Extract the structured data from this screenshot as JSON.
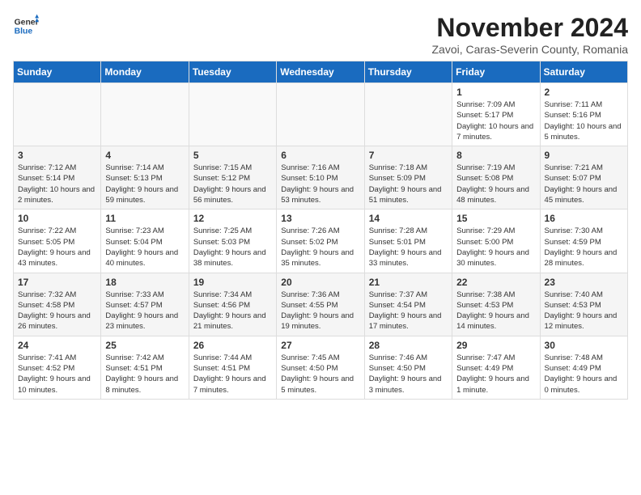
{
  "header": {
    "logo_line1": "General",
    "logo_line2": "Blue",
    "month_title": "November 2024",
    "location": "Zavoi, Caras-Severin County, Romania"
  },
  "weekdays": [
    "Sunday",
    "Monday",
    "Tuesday",
    "Wednesday",
    "Thursday",
    "Friday",
    "Saturday"
  ],
  "weeks": [
    [
      {
        "day": "",
        "info": ""
      },
      {
        "day": "",
        "info": ""
      },
      {
        "day": "",
        "info": ""
      },
      {
        "day": "",
        "info": ""
      },
      {
        "day": "",
        "info": ""
      },
      {
        "day": "1",
        "info": "Sunrise: 7:09 AM\nSunset: 5:17 PM\nDaylight: 10 hours and 7 minutes."
      },
      {
        "day": "2",
        "info": "Sunrise: 7:11 AM\nSunset: 5:16 PM\nDaylight: 10 hours and 5 minutes."
      }
    ],
    [
      {
        "day": "3",
        "info": "Sunrise: 7:12 AM\nSunset: 5:14 PM\nDaylight: 10 hours and 2 minutes."
      },
      {
        "day": "4",
        "info": "Sunrise: 7:14 AM\nSunset: 5:13 PM\nDaylight: 9 hours and 59 minutes."
      },
      {
        "day": "5",
        "info": "Sunrise: 7:15 AM\nSunset: 5:12 PM\nDaylight: 9 hours and 56 minutes."
      },
      {
        "day": "6",
        "info": "Sunrise: 7:16 AM\nSunset: 5:10 PM\nDaylight: 9 hours and 53 minutes."
      },
      {
        "day": "7",
        "info": "Sunrise: 7:18 AM\nSunset: 5:09 PM\nDaylight: 9 hours and 51 minutes."
      },
      {
        "day": "8",
        "info": "Sunrise: 7:19 AM\nSunset: 5:08 PM\nDaylight: 9 hours and 48 minutes."
      },
      {
        "day": "9",
        "info": "Sunrise: 7:21 AM\nSunset: 5:07 PM\nDaylight: 9 hours and 45 minutes."
      }
    ],
    [
      {
        "day": "10",
        "info": "Sunrise: 7:22 AM\nSunset: 5:05 PM\nDaylight: 9 hours and 43 minutes."
      },
      {
        "day": "11",
        "info": "Sunrise: 7:23 AM\nSunset: 5:04 PM\nDaylight: 9 hours and 40 minutes."
      },
      {
        "day": "12",
        "info": "Sunrise: 7:25 AM\nSunset: 5:03 PM\nDaylight: 9 hours and 38 minutes."
      },
      {
        "day": "13",
        "info": "Sunrise: 7:26 AM\nSunset: 5:02 PM\nDaylight: 9 hours and 35 minutes."
      },
      {
        "day": "14",
        "info": "Sunrise: 7:28 AM\nSunset: 5:01 PM\nDaylight: 9 hours and 33 minutes."
      },
      {
        "day": "15",
        "info": "Sunrise: 7:29 AM\nSunset: 5:00 PM\nDaylight: 9 hours and 30 minutes."
      },
      {
        "day": "16",
        "info": "Sunrise: 7:30 AM\nSunset: 4:59 PM\nDaylight: 9 hours and 28 minutes."
      }
    ],
    [
      {
        "day": "17",
        "info": "Sunrise: 7:32 AM\nSunset: 4:58 PM\nDaylight: 9 hours and 26 minutes."
      },
      {
        "day": "18",
        "info": "Sunrise: 7:33 AM\nSunset: 4:57 PM\nDaylight: 9 hours and 23 minutes."
      },
      {
        "day": "19",
        "info": "Sunrise: 7:34 AM\nSunset: 4:56 PM\nDaylight: 9 hours and 21 minutes."
      },
      {
        "day": "20",
        "info": "Sunrise: 7:36 AM\nSunset: 4:55 PM\nDaylight: 9 hours and 19 minutes."
      },
      {
        "day": "21",
        "info": "Sunrise: 7:37 AM\nSunset: 4:54 PM\nDaylight: 9 hours and 17 minutes."
      },
      {
        "day": "22",
        "info": "Sunrise: 7:38 AM\nSunset: 4:53 PM\nDaylight: 9 hours and 14 minutes."
      },
      {
        "day": "23",
        "info": "Sunrise: 7:40 AM\nSunset: 4:53 PM\nDaylight: 9 hours and 12 minutes."
      }
    ],
    [
      {
        "day": "24",
        "info": "Sunrise: 7:41 AM\nSunset: 4:52 PM\nDaylight: 9 hours and 10 minutes."
      },
      {
        "day": "25",
        "info": "Sunrise: 7:42 AM\nSunset: 4:51 PM\nDaylight: 9 hours and 8 minutes."
      },
      {
        "day": "26",
        "info": "Sunrise: 7:44 AM\nSunset: 4:51 PM\nDaylight: 9 hours and 7 minutes."
      },
      {
        "day": "27",
        "info": "Sunrise: 7:45 AM\nSunset: 4:50 PM\nDaylight: 9 hours and 5 minutes."
      },
      {
        "day": "28",
        "info": "Sunrise: 7:46 AM\nSunset: 4:50 PM\nDaylight: 9 hours and 3 minutes."
      },
      {
        "day": "29",
        "info": "Sunrise: 7:47 AM\nSunset: 4:49 PM\nDaylight: 9 hours and 1 minute."
      },
      {
        "day": "30",
        "info": "Sunrise: 7:48 AM\nSunset: 4:49 PM\nDaylight: 9 hours and 0 minutes."
      }
    ]
  ]
}
